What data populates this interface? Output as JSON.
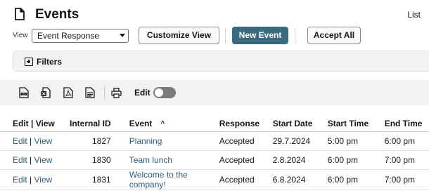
{
  "header": {
    "title": "Events",
    "list_link": "List"
  },
  "toolbar": {
    "view_label": "View",
    "view_value": "Event Response",
    "customize_label": "Customize View",
    "new_event_label": "New Event",
    "accept_all_label": "Accept All"
  },
  "filters": {
    "label": "Filters"
  },
  "icon_bar": {
    "icons": [
      "export-csv-icon",
      "export-excel-icon",
      "export-pdf-icon",
      "export-doc-icon",
      "print-icon"
    ],
    "edit_label": "Edit",
    "edit_toggle_on": false
  },
  "table": {
    "columns": [
      "Edit | View",
      "Internal ID",
      "Event",
      "Response",
      "Start Date",
      "Start Time",
      "End Time"
    ],
    "sort_indicator": "^",
    "rows": [
      {
        "edit": "Edit",
        "view": "View",
        "internal_id": "1827",
        "event": "Planning",
        "response": "Accepted",
        "start_date": "29.7.2024",
        "start_time": "5:00 pm",
        "end_time": "6:00 pm"
      },
      {
        "edit": "Edit",
        "view": "View",
        "internal_id": "1830",
        "event": "Team lunch",
        "response": "Accepted",
        "start_date": "2.8.2024",
        "start_time": "6:00 pm",
        "end_time": "7:00 pm"
      },
      {
        "edit": "Edit",
        "view": "View",
        "internal_id": "1831",
        "event": "Welcome to the company!",
        "response": "Accepted",
        "start_date": "6.8.2024",
        "start_time": "6:00 pm",
        "end_time": "7:00 pm"
      }
    ]
  },
  "colors": {
    "primary_button": "#3a6a7e",
    "link": "#2d5d7b",
    "bar_background": "#f3f2f0"
  }
}
